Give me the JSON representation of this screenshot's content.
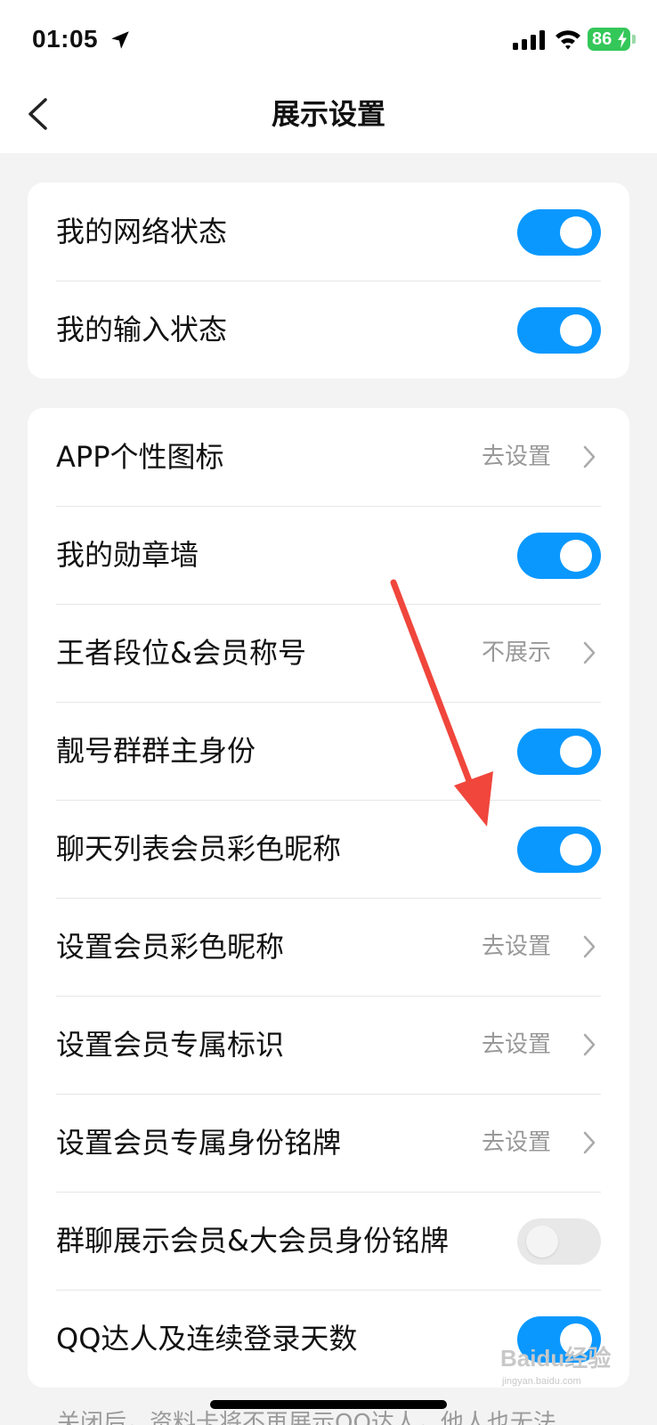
{
  "status_bar": {
    "time": "01:05",
    "battery": "86",
    "icons": [
      "location-arrow-icon",
      "cellular-signal-icon",
      "wifi-icon",
      "battery-charging-icon"
    ]
  },
  "nav": {
    "title": "展示设置",
    "back_icon": "chevron-left-icon"
  },
  "section1": {
    "rows": [
      {
        "label": "我的网络状态",
        "toggle": true
      },
      {
        "label": "我的输入状态",
        "toggle": true
      }
    ]
  },
  "section2": {
    "rows": [
      {
        "label": "APP个性图标",
        "value": "去设置"
      },
      {
        "label": "我的勋章墙",
        "toggle": true
      },
      {
        "label": "王者段位&会员称号",
        "value": "不展示"
      },
      {
        "label": "靓号群群主身份",
        "toggle": true
      },
      {
        "label": "聊天列表会员彩色昵称",
        "toggle": true
      },
      {
        "label": "设置会员彩色昵称",
        "value": "去设置"
      },
      {
        "label": "设置会员专属标识",
        "value": "去设置"
      },
      {
        "label": "设置会员专属身份铭牌",
        "value": "去设置"
      },
      {
        "label": "群聊展示会员&大会员身份铭牌",
        "toggle": false
      },
      {
        "label": "QQ达人及连续登录天数",
        "toggle": true
      }
    ]
  },
  "footer_note": "关闭后，资料卡将不再展示QQ达人，他人也无法",
  "colors": {
    "toggle_on": "#0a98ff",
    "toggle_off": "#e8e8e8",
    "annotation_arrow": "#f0463c",
    "battery": "#34c759"
  },
  "annotation": {
    "type": "red-arrow",
    "points_to": "聊天列表会员彩色昵称"
  },
  "watermark": {
    "text": "Baidu经验",
    "subtext": "jingyan.baidu.com"
  }
}
